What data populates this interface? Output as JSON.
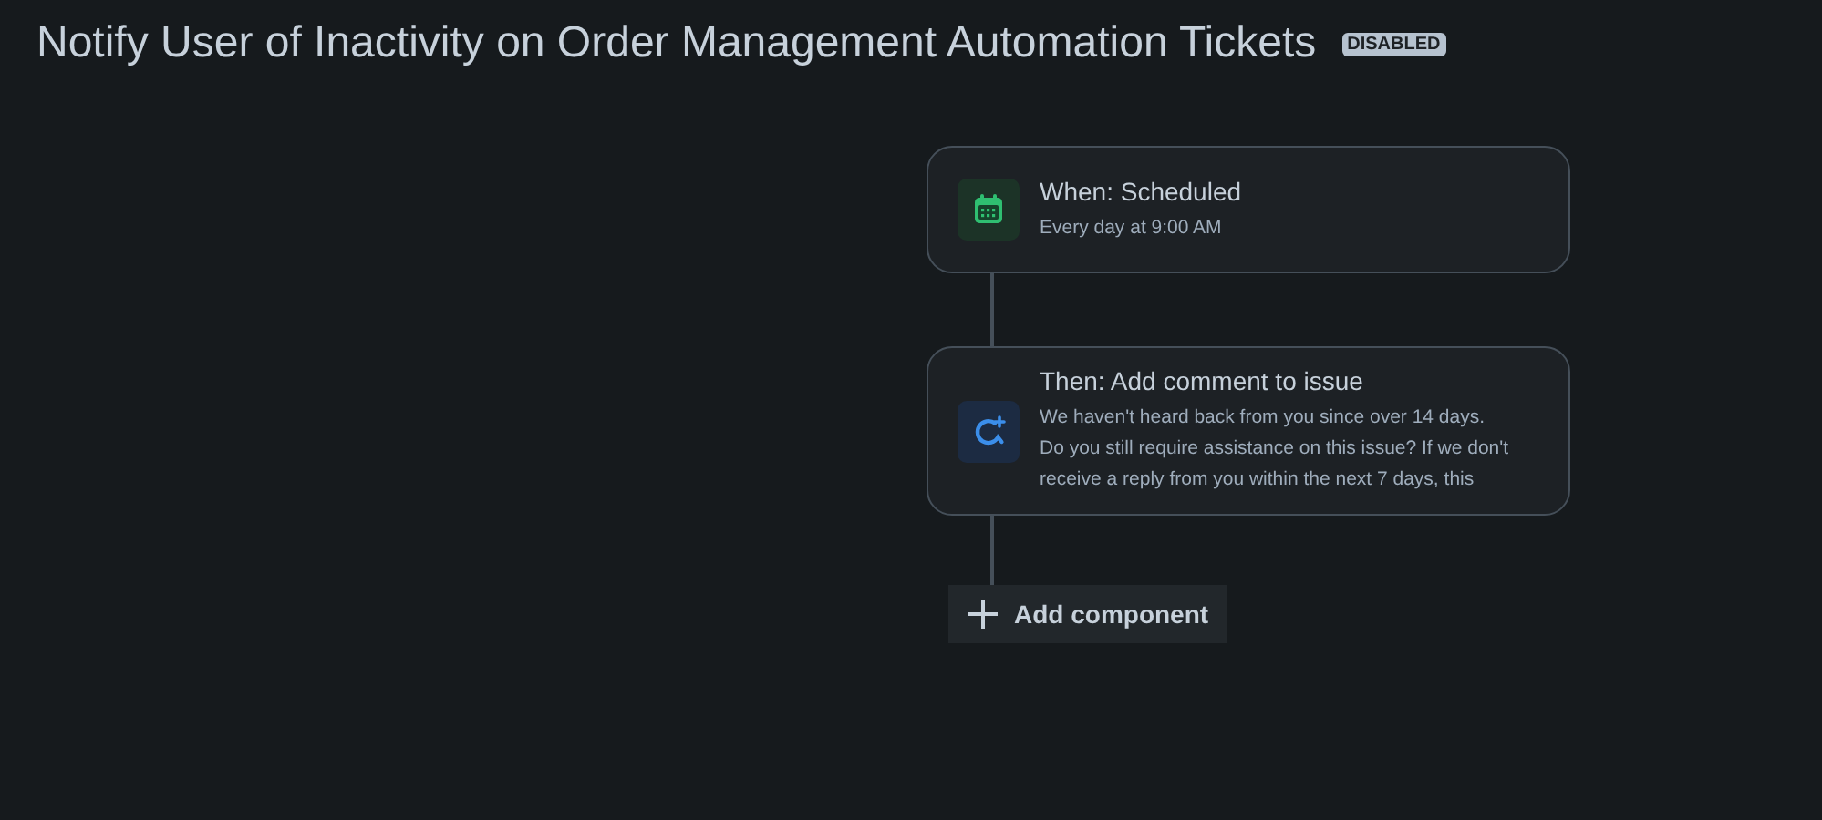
{
  "header": {
    "title": "Notify User of Inactivity on Order Management Automation Tickets",
    "status": "DISABLED"
  },
  "components": [
    {
      "kind": "trigger",
      "title": "When: Scheduled",
      "description_lines": [
        "Every day at 9:00 AM"
      ]
    },
    {
      "kind": "action",
      "title": "Then: Add comment to issue",
      "description_lines": [
        "We haven't heard back from you since over 14 days.",
        "Do you still require assistance on this issue? If we don't",
        "receive a reply from you within the next 7 days, this"
      ]
    }
  ],
  "add_button": {
    "label": "Add component"
  }
}
